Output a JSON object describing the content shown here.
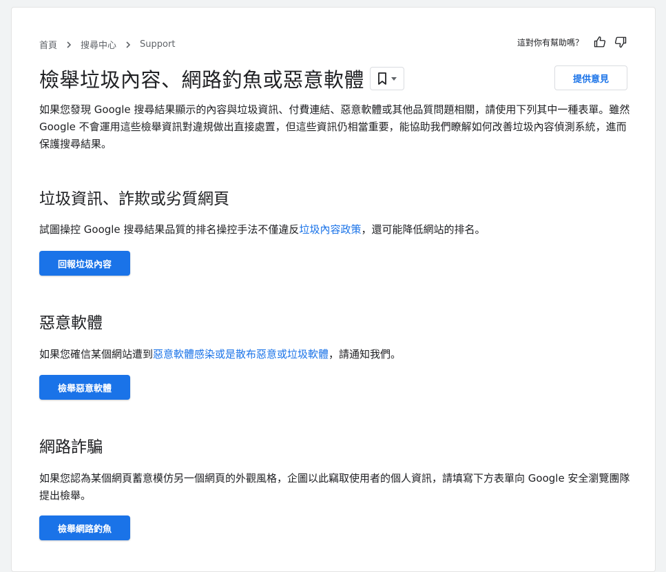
{
  "breadcrumb": {
    "items": [
      "首頁",
      "搜尋中心",
      "Support"
    ]
  },
  "helpful": {
    "question": "這對你有幫助嗎？",
    "icons": [
      "thumb-up-icon",
      "thumb-down-icon"
    ]
  },
  "header": {
    "title": "檢舉垃圾內容、網路釣魚或惡意軟體",
    "feedback_label": "提供意見",
    "bookmark_icon": "bookmark-icon"
  },
  "intro": "如果您發現 Google 搜尋結果顯示的內容與垃圾資訊、付費連結、惡意軟體或其他品質問題相關，請使用下列其中一種表單。雖然 Google 不會運用這些檢舉資訊對違規做出直接處置，但這些資訊仍相當重要，能協助我們瞭解如何改善垃圾內容偵測系統，進而保護搜尋結果。",
  "sections": [
    {
      "heading": "垃圾資訊、詐欺或劣質網頁",
      "text_before": "試圖操控 Google 搜尋結果品質的排名操控手法不僅違反",
      "link": "垃圾內容政策",
      "text_after": "，還可能降低網站的排名。",
      "button": "回報垃圾內容"
    },
    {
      "heading": "惡意軟體",
      "text_before": "如果您確信某個網站遭到",
      "link": "惡意軟體感染或是散布惡意或垃圾軟體",
      "text_after": "，請通知我們。",
      "button": "檢舉惡意軟體"
    },
    {
      "heading": "網路詐騙",
      "text_before": "如果您認為某個網頁蓄意模仿另一個網頁的外觀風格，企圖以此竊取使用者的個人資訊，請填寫下方表單向 Google 安全瀏覽團隊提出檢舉。",
      "link": "",
      "text_after": "",
      "button": "檢舉網路釣魚"
    }
  ],
  "colors": {
    "accent": "#1a73e8",
    "text": "#202124",
    "muted": "#5f6368"
  }
}
